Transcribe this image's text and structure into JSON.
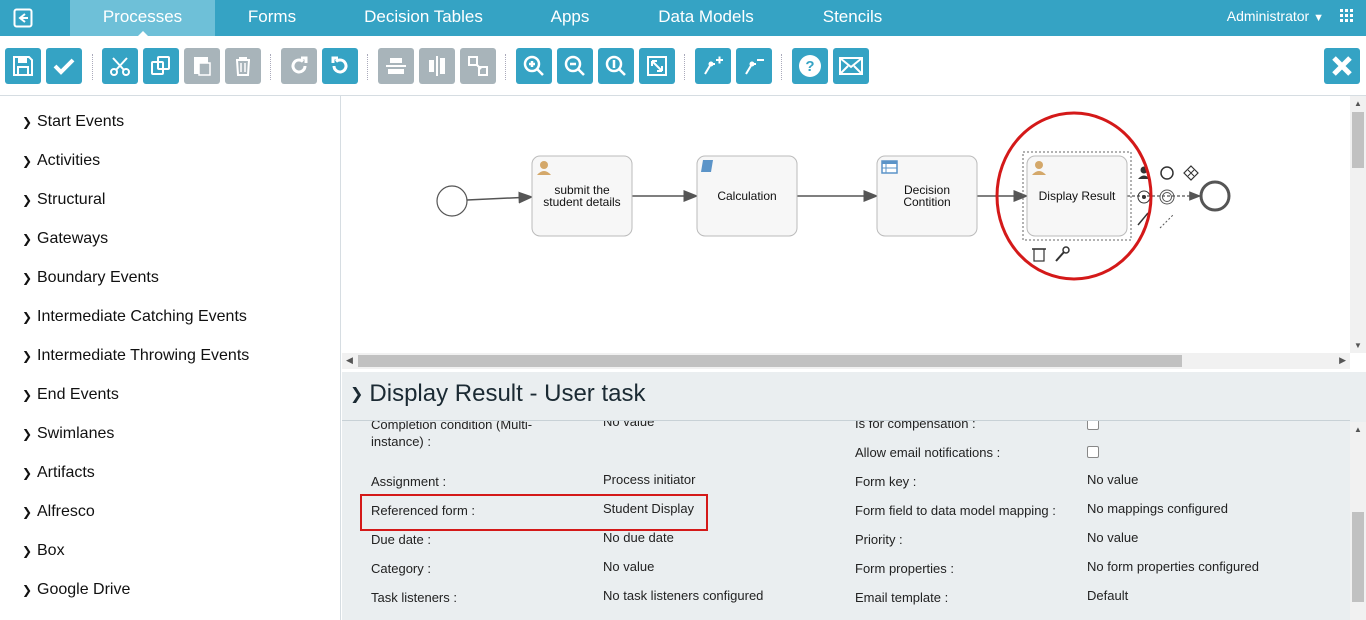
{
  "nav": {
    "tabs": [
      "Processes",
      "Forms",
      "Decision Tables",
      "Apps",
      "Data Models",
      "Stencils"
    ],
    "active_tab": "Processes",
    "user": "Administrator"
  },
  "toolbar": {
    "buttons": [
      "save",
      "validate",
      "cut",
      "copy",
      "paste",
      "delete",
      "redo",
      "undo",
      "align-horizontal",
      "align-vertical",
      "same-size",
      "zoom-in",
      "zoom-out",
      "zoom-actual",
      "zoom-fit",
      "add-bendpoint",
      "remove-bendpoint",
      "help",
      "feedback"
    ],
    "close": "close"
  },
  "palette": {
    "items": [
      "Start Events",
      "Activities",
      "Structural",
      "Gateways",
      "Boundary Events",
      "Intermediate Catching Events",
      "Intermediate Throwing Events",
      "End Events",
      "Swimlanes",
      "Artifacts",
      "Alfresco",
      "Box",
      "Google Drive"
    ]
  },
  "diagram": {
    "tasks": [
      {
        "label1": "submit the",
        "label2": "student details",
        "type": "user"
      },
      {
        "label1": "Calculation",
        "label2": "",
        "type": "script"
      },
      {
        "label1": "Decision",
        "label2": "Contition",
        "type": "decision"
      },
      {
        "label1": "Display Result",
        "label2": "",
        "type": "user"
      }
    ]
  },
  "properties": {
    "title": "Display Result - User task",
    "left": [
      {
        "label": "Completion condition (Multi-",
        "label2": "instance) :",
        "value": "No value"
      },
      {
        "label": "Assignment :",
        "value": "Process initiator"
      },
      {
        "label": "Referenced form :",
        "value": "Student Display"
      },
      {
        "label": "Due date :",
        "value": "No due date"
      },
      {
        "label": "Category :",
        "value": "No value"
      },
      {
        "label": "Task listeners :",
        "value": "No task listeners configured"
      }
    ],
    "right": [
      {
        "label": "Is for compensation :",
        "value": ""
      },
      {
        "label": "Allow email notifications :",
        "value": ""
      },
      {
        "label": "Form key :",
        "value": "No value"
      },
      {
        "label": "Form field to data model mapping :",
        "value": "No mappings configured"
      },
      {
        "label": "Priority :",
        "value": "No value"
      },
      {
        "label": "Form properties :",
        "value": "No form properties configured"
      },
      {
        "label": "Email template :",
        "value": "Default"
      }
    ]
  },
  "colors": {
    "nav": "#35a3c4",
    "accent_button": "#35a3c4",
    "disabled_button": "#a8b4ba",
    "highlight": "#d41919"
  }
}
